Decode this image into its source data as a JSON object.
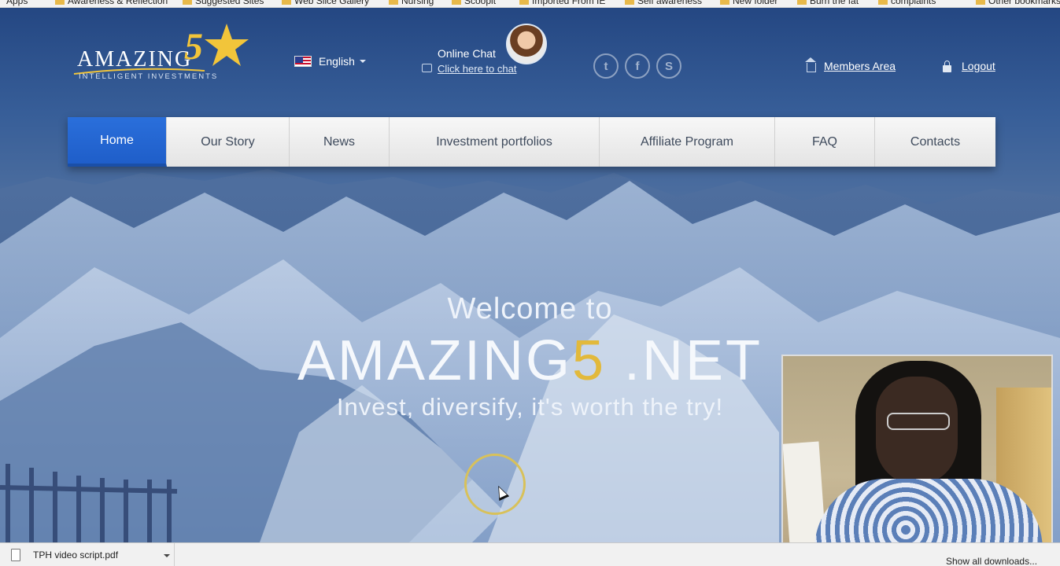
{
  "bookmarks": [
    "Apps",
    "Awareness & Reflection",
    "Suggested Sites",
    "Web Slice Gallery",
    "Nursing",
    "Scoopit",
    "Imported From IE",
    "Self awareness",
    "New folder",
    "Burn the fat",
    "complaints",
    "Other bookmarks"
  ],
  "header": {
    "logo_word": "AMAZING",
    "logo_five": "5",
    "logo_sub": "INTELLIGENT INVESTMENTS",
    "language": "English",
    "chat_title": "Online Chat",
    "chat_link": "Click here to chat",
    "social": [
      "twitter",
      "facebook",
      "skype"
    ],
    "social_glyphs": [
      "t",
      "f",
      "S"
    ],
    "members_area": "Members Area",
    "logout": "Logout"
  },
  "nav": {
    "items": [
      "Home",
      "Our Story",
      "News",
      "Investment portfolios",
      "Affiliate Program",
      "FAQ",
      "Contacts"
    ],
    "active": "Home"
  },
  "hero": {
    "welcome": "Welcome to",
    "brand_pre": "AMAZING",
    "brand_five": "5",
    "brand_post": " .NET",
    "tagline": "Invest, diversify, it's worth the try!"
  },
  "downloads": {
    "file": "TPH video script.pdf",
    "show_all": "Show all downloads..."
  },
  "colors": {
    "accent_blue": "#2a6fdb",
    "gold": "#e2b93b"
  }
}
